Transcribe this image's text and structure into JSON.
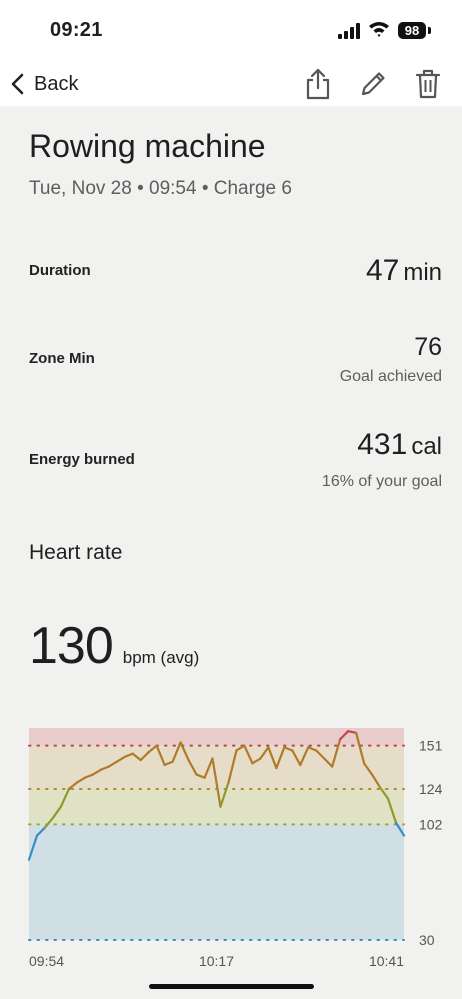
{
  "status_bar": {
    "time": "09:21",
    "battery": "98"
  },
  "nav": {
    "back_label": "Back",
    "icons": [
      "share-icon",
      "edit-icon",
      "trash-icon"
    ]
  },
  "activity": {
    "title": "Rowing machine",
    "subtitle": "Tue, Nov 28 • 09:54 • Charge 6"
  },
  "stats": {
    "duration": {
      "label": "Duration",
      "value": "47",
      "unit": "min"
    },
    "zone_min": {
      "label": "Zone Min",
      "value": "76",
      "note": "Goal achieved"
    },
    "energy": {
      "label": "Energy burned",
      "value": "431",
      "unit": "cal",
      "note": "16% of your goal"
    }
  },
  "heart_rate": {
    "title": "Heart rate",
    "avg": "130",
    "avg_unit": "bpm (avg)"
  },
  "chart_data": {
    "type": "line",
    "y_ticks": [
      "151",
      "124",
      "102",
      "30"
    ],
    "x_ticks": [
      "09:54",
      "10:17",
      "10:41"
    ],
    "zones": [
      {
        "from": 151,
        "to": 162,
        "color": "#e8cccc"
      },
      {
        "from": 124,
        "to": 151,
        "color": "#e6ddc9"
      },
      {
        "from": 102,
        "to": 124,
        "color": "#e0e2c6"
      },
      {
        "from": 30,
        "to": 102,
        "color": "#d0dfe6"
      }
    ],
    "threshold_colors": {
      "151": "#c0414a",
      "124": "#b08a2e",
      "102": "#9aa53a",
      "30": "#3a8cc4"
    },
    "line_colors": {
      "low": "#3a8cc4",
      "light": "#8e9a26",
      "moderate": "#b07a28",
      "peak": "#c8424a"
    },
    "ylim": [
      30,
      162
    ],
    "x_range_min": [
      0,
      47
    ],
    "x": [
      0,
      1,
      2,
      3,
      4,
      5,
      6,
      7,
      8,
      9,
      10,
      11,
      12,
      13,
      14,
      15,
      16,
      17,
      18,
      19,
      20,
      21,
      22,
      23,
      24,
      25,
      26,
      27,
      28,
      29,
      30,
      31,
      32,
      33,
      34,
      35,
      36,
      37,
      38,
      39,
      40,
      41,
      42,
      43,
      44,
      45,
      46,
      47
    ],
    "values": [
      80,
      95,
      100,
      106,
      113,
      124,
      128,
      131,
      133,
      136,
      138,
      141,
      144,
      146,
      142,
      147,
      151,
      139,
      141,
      153,
      142,
      133,
      131,
      143,
      113,
      128,
      148,
      151,
      140,
      143,
      150,
      137,
      150,
      148,
      139,
      150,
      148,
      143,
      138,
      155,
      160,
      159,
      140,
      133,
      125,
      118,
      103,
      95
    ]
  }
}
